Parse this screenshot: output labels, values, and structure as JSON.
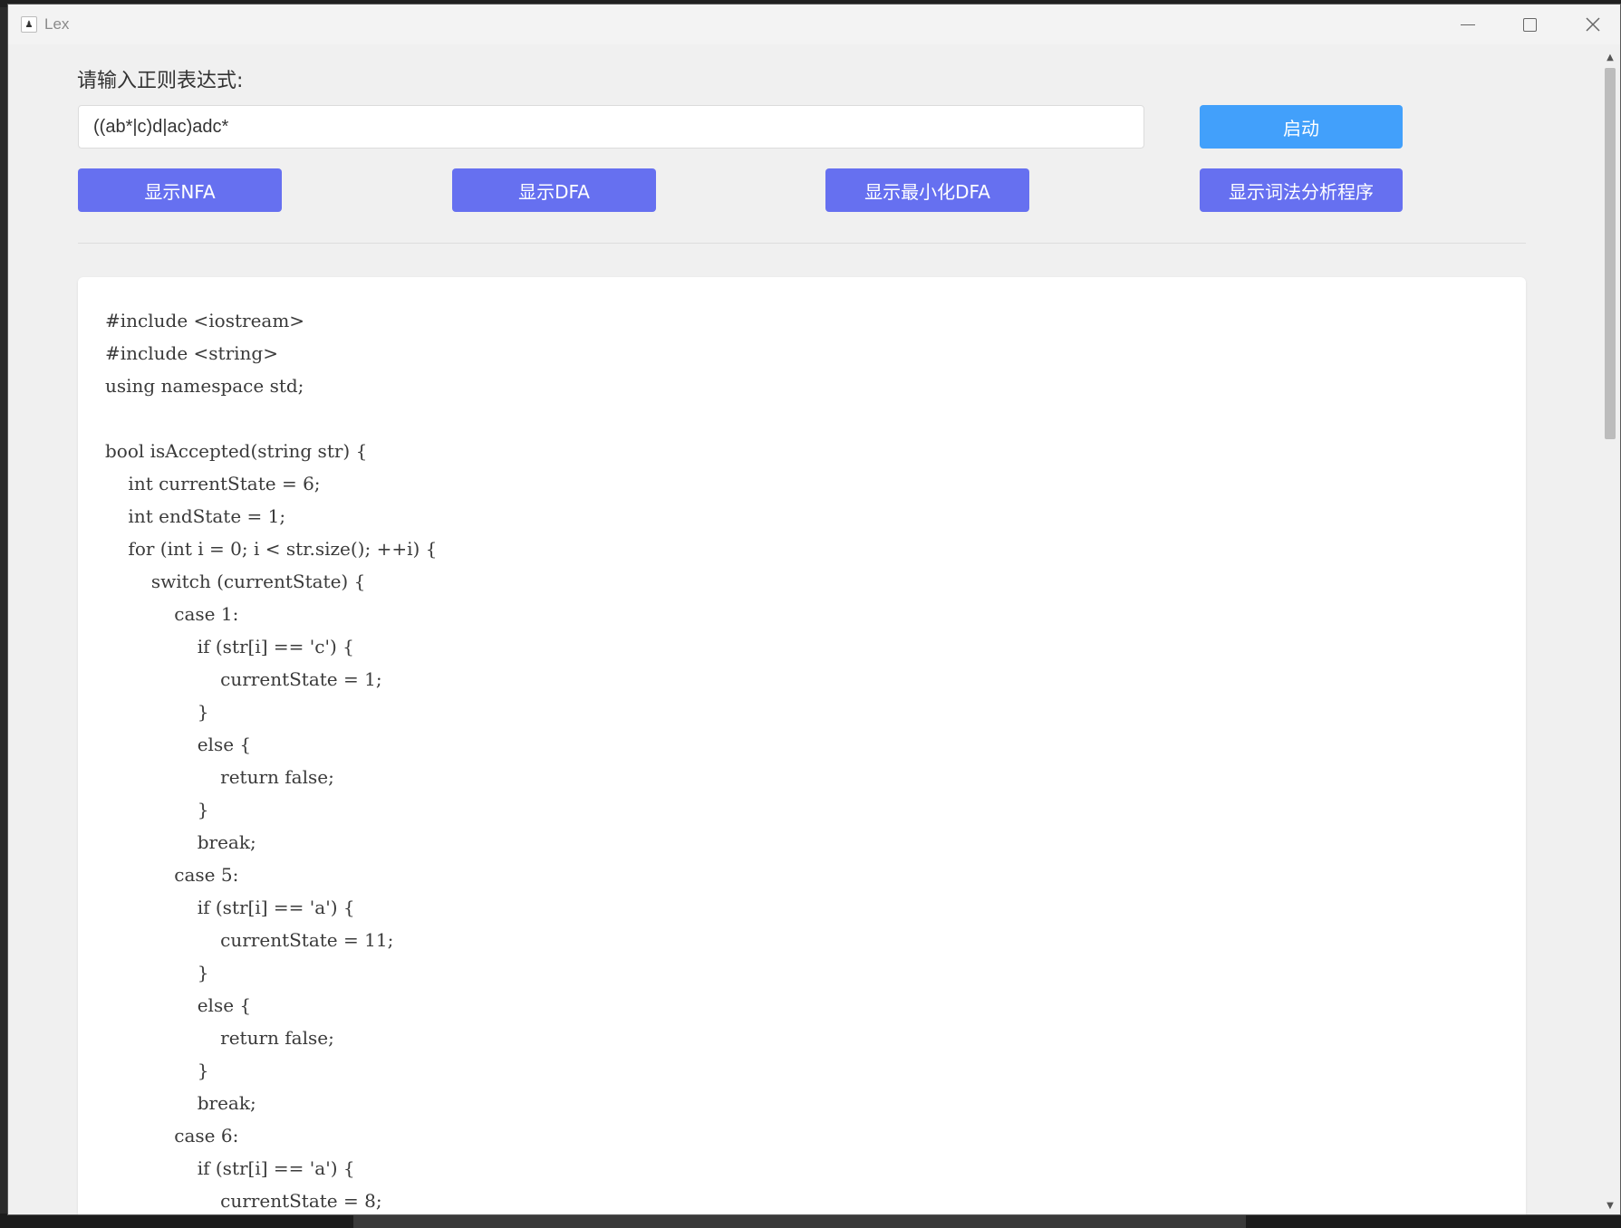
{
  "window": {
    "title": "Lex"
  },
  "form": {
    "prompt_label": "请输入正则表达式:",
    "regex_value": "((ab*|c)d|ac)adc*",
    "start_button": "启动"
  },
  "actions": {
    "show_nfa": "显示NFA",
    "show_dfa": "显示DFA",
    "show_min_dfa": "显示最小化DFA",
    "show_lex_program": "显示词法分析程序"
  },
  "colors": {
    "start_button": "#42a0fb",
    "action_button": "#6670f0"
  },
  "code": {
    "lines": [
      "#include <iostream>",
      "#include <string>",
      "using namespace std;",
      "",
      "bool isAccepted(string str) {",
      "    int currentState = 6;",
      "    int endState = 1;",
      "    for (int i = 0; i < str.size(); ++i) {",
      "        switch (currentState) {",
      "            case 1:",
      "                if (str[i] == 'c') {",
      "                    currentState = 1;",
      "                }",
      "                else {",
      "                    return false;",
      "                }",
      "                break;",
      "            case 5:",
      "                if (str[i] == 'a') {",
      "                    currentState = 11;",
      "                }",
      "                else {",
      "                    return false;",
      "                }",
      "                break;",
      "            case 6:",
      "                if (str[i] == 'a') {",
      "                    currentState = 8;"
    ]
  },
  "scrollbar": {
    "position_fraction": 0.0,
    "visible_fraction": 0.33
  }
}
